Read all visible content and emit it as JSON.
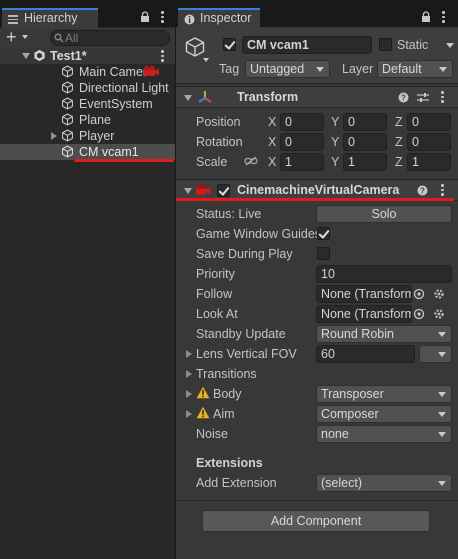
{
  "hierarchy": {
    "tab_label": "Hierarchy",
    "add_label": "+",
    "search_placeholder": "All",
    "scene_name": "Test1*",
    "items": [
      {
        "label": "Main Camera"
      },
      {
        "label": "Directional Light"
      },
      {
        "label": "EventSystem"
      },
      {
        "label": "Plane"
      },
      {
        "label": "Player"
      },
      {
        "label": "CM vcam1"
      }
    ]
  },
  "inspector": {
    "tab_label": "Inspector",
    "object_name": "CM vcam1",
    "static_label": "Static",
    "tag_label": "Tag",
    "tag_value": "Untagged",
    "layer_label": "Layer",
    "layer_value": "Default",
    "transform": {
      "title": "Transform",
      "rows": [
        {
          "label": "Position",
          "x": "0",
          "y": "0",
          "z": "0"
        },
        {
          "label": "Rotation",
          "x": "0",
          "y": "0",
          "z": "0"
        },
        {
          "label": "Scale",
          "x": "1",
          "y": "1",
          "z": "1"
        }
      ],
      "axis_x": "X",
      "axis_y": "Y",
      "axis_z": "Z"
    },
    "vcam": {
      "title": "CinemachineVirtualCamera",
      "status_label": "Status: Live",
      "solo_label": "Solo",
      "game_window_guides_label": "Game Window Guides",
      "game_window_guides": true,
      "save_during_play_label": "Save During Play",
      "save_during_play": false,
      "priority_label": "Priority",
      "priority_value": "10",
      "follow_label": "Follow",
      "follow_value": "None (Transform)",
      "lookat_label": "Look At",
      "lookat_value": "None (Transform)",
      "standby_label": "Standby Update",
      "standby_value": "Round Robin",
      "lens_label": "Lens Vertical FOV",
      "lens_value": "60",
      "transitions_label": "Transitions",
      "body_label": "Body",
      "body_value": "Transposer",
      "aim_label": "Aim",
      "aim_value": "Composer",
      "noise_label": "Noise",
      "noise_value": "none",
      "extensions_label": "Extensions",
      "add_extension_label": "Add Extension",
      "add_extension_value": "(select)"
    },
    "add_component_label": "Add Component"
  },
  "colors": {
    "accent_blue": "#3a7fd8",
    "annotation_red": "#e11b1b",
    "warning_yellow": "#e8b41b"
  }
}
